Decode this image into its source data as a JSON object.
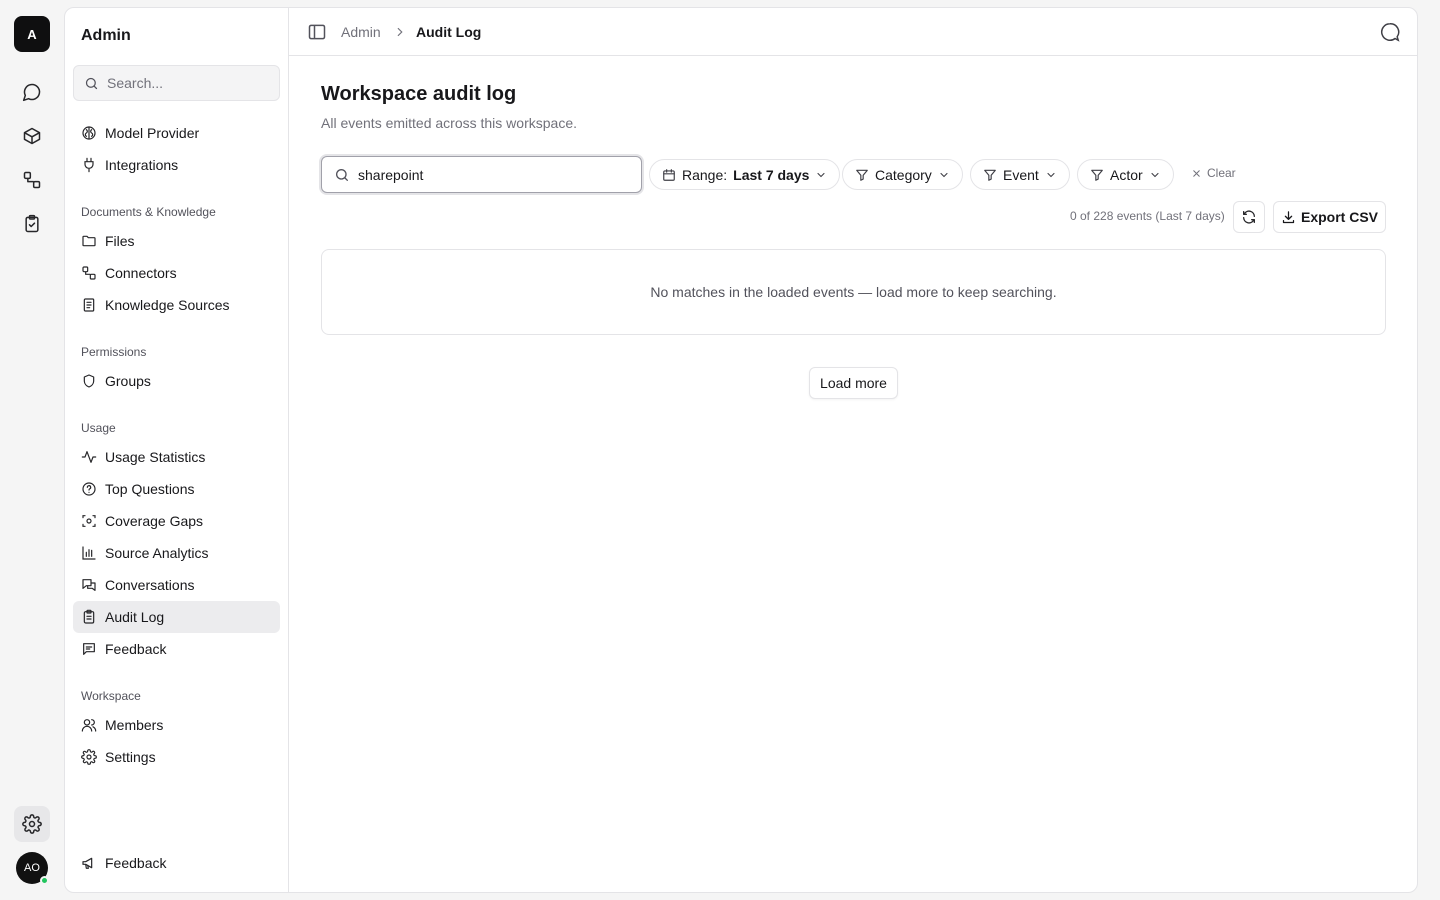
{
  "rail": {
    "workspace_initial": "A",
    "items": [
      {
        "icon": "chat-icon"
      },
      {
        "icon": "cube-icon"
      },
      {
        "icon": "connectors-icon"
      },
      {
        "icon": "clipboard-check-icon"
      }
    ],
    "settings_icon": "gear-icon",
    "user_initials": "AO",
    "status_color": "#22c55e"
  },
  "sidebar": {
    "title": "Admin",
    "search_placeholder": "Search...",
    "top_items": [
      {
        "label": "Model Provider",
        "icon": "brain-icon"
      },
      {
        "label": "Integrations",
        "icon": "plug-icon"
      }
    ],
    "sections": [
      {
        "title": "Documents & Knowledge",
        "items": [
          {
            "label": "Files",
            "icon": "folder-icon"
          },
          {
            "label": "Connectors",
            "icon": "connectors-icon"
          },
          {
            "label": "Knowledge Sources",
            "icon": "book-icon"
          }
        ]
      },
      {
        "title": "Permissions",
        "items": [
          {
            "label": "Groups",
            "icon": "shield-icon"
          }
        ]
      },
      {
        "title": "Usage",
        "items": [
          {
            "label": "Usage Statistics",
            "icon": "activity-icon"
          },
          {
            "label": "Top Questions",
            "icon": "question-circle-icon"
          },
          {
            "label": "Coverage Gaps",
            "icon": "scan-icon"
          },
          {
            "label": "Source Analytics",
            "icon": "bar-chart-icon"
          },
          {
            "label": "Conversations",
            "icon": "messages-icon"
          },
          {
            "label": "Audit Log",
            "icon": "clipboard-list-icon",
            "active": true
          },
          {
            "label": "Feedback",
            "icon": "message-square-text-icon"
          }
        ]
      },
      {
        "title": "Workspace",
        "items": [
          {
            "label": "Members",
            "icon": "users-icon"
          },
          {
            "label": "Settings",
            "icon": "gear-icon"
          }
        ]
      }
    ],
    "footer_item": {
      "label": "Feedback",
      "icon": "megaphone-icon"
    }
  },
  "breadcrumb": {
    "parent": "Admin",
    "current": "Audit Log"
  },
  "page": {
    "title": "Workspace audit log",
    "subtitle": "All events emitted across this workspace."
  },
  "filters": {
    "search_value": "sharepoint",
    "range_label": "Range:",
    "range_value": "Last 7 days",
    "category": "Category",
    "event": "Event",
    "actor": "Actor",
    "clear": "Clear"
  },
  "results": {
    "count_text": "0 of 228 events (Last 7 days)",
    "export_label": "Export CSV",
    "empty_message": "No matches in the loaded events — load more to keep searching.",
    "load_more": "Load more"
  }
}
